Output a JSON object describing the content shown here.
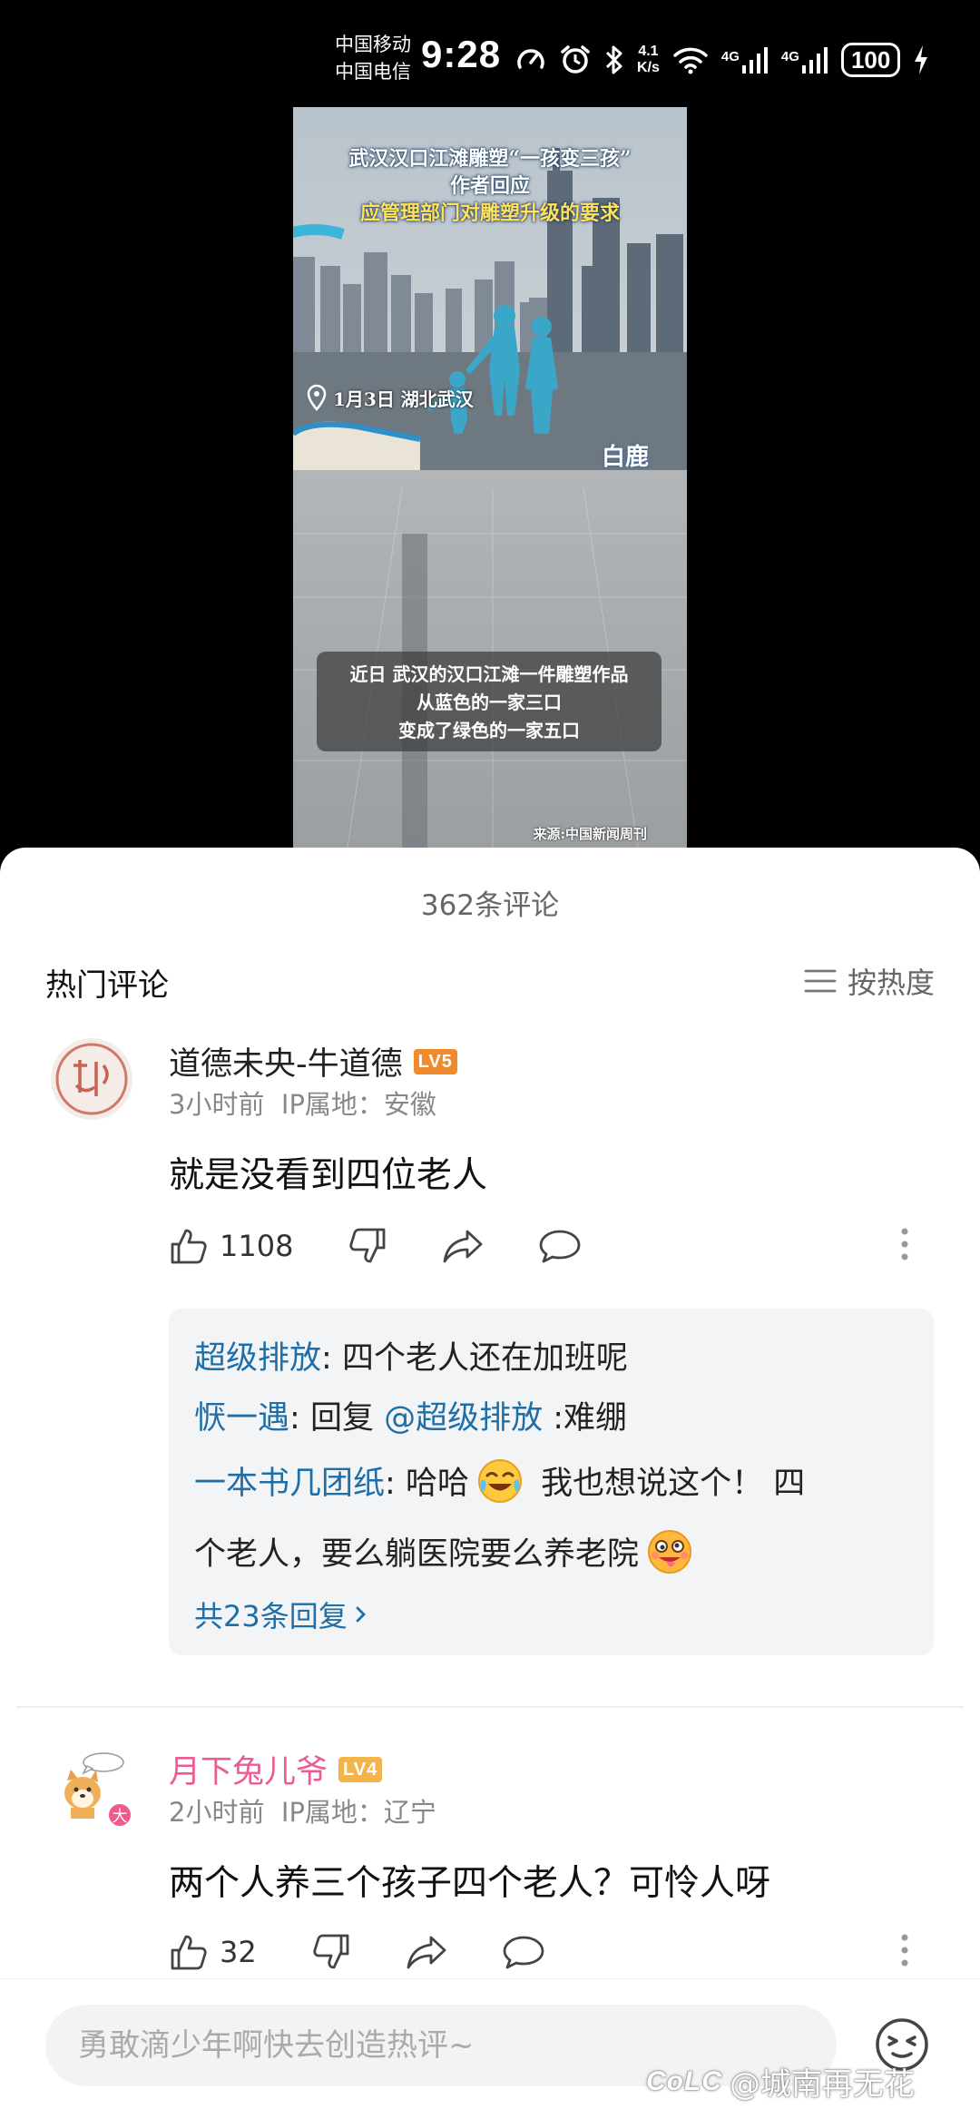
{
  "status_bar": {
    "carrier_1": "中国移动",
    "carrier_2": "中国电信",
    "time": "9:28",
    "speed_value": "4.1",
    "speed_unit": "K/s",
    "net_1": "4G",
    "net_2": "4G",
    "battery": "100",
    "icons": [
      "speedometer-icon",
      "alarm-icon",
      "bluetooth-icon",
      "wifi-icon",
      "signal-icon",
      "signal-icon",
      "charging-icon"
    ]
  },
  "video": {
    "title_line_1": "武汉汉口江滩雕塑“一孩变三孩”",
    "title_line_2": "作者回应",
    "title_line_3": "应管理部门对雕塑升级的要求",
    "location": "1月3日 湖北武汉",
    "brand": "白鹿",
    "caption_line_1": "近日 武汉的汉口江滩一件雕塑作品",
    "caption_line_2": "从蓝色的一家三口",
    "caption_line_3": "变成了绿色的一家五口",
    "source": "来源:中国新闻周刊"
  },
  "comments_header": {
    "count_label": "362条评论",
    "hot_label": "热门评论",
    "sort_label": "按热度"
  },
  "comments": [
    {
      "username": "道德未央-牛道德",
      "level": "LV5",
      "level_color": "#f08a2a",
      "time": "3小时前",
      "ip": "IP属地：安徽",
      "text": "就是没看到四位老人",
      "likes": "1108",
      "replies": [
        {
          "author": "超级排放",
          "sep": ": ",
          "text": "四个老人还在加班呢"
        },
        {
          "author": "恹一遇",
          "sep": ": ",
          "prefix": "回复 ",
          "mention": "@超级排放",
          "text": " :难绷"
        },
        {
          "author": "一本书几团纸",
          "sep": ": ",
          "text_a": "哈哈",
          "text_b": " 我也想说这个！ 四",
          "text_c": "个老人，要么躺医院要么养老院"
        }
      ],
      "more_replies": "共23条回复"
    },
    {
      "username": "月下兔儿爷",
      "level": "LV4",
      "level_color": "#f3b54a",
      "time": "2小时前",
      "ip": "IP属地：辽宁",
      "text": "两个人养三个孩子四个老人？可怜人呀",
      "likes": "32",
      "avatar_badge": "大"
    }
  ],
  "input": {
    "placeholder": "勇敢滴少年啊快去创造热评~"
  },
  "watermark": {
    "logo": "CoLC",
    "text": "@城南再无花"
  }
}
